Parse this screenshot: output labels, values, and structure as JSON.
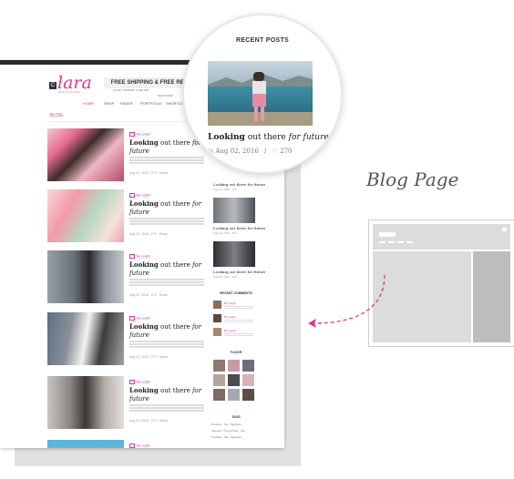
{
  "logo": {
    "box": "C",
    "name": "lara",
    "tagline": "SEW FASHION"
  },
  "promo": {
    "title": "FREE SHIPPING & FREE RETURNS",
    "subtitle": "ON ALL ORDERS OVER $99",
    "link": "SHOP NOW"
  },
  "nav": {
    "items": [
      "HOME",
      "SHOP",
      "PAGES",
      "PORTFOLIO",
      "SHORTCODES"
    ]
  },
  "breadcrumb": "BLOG",
  "posts": [
    {
      "category": "By Leight",
      "title_bold": "Looking",
      "title_plain": "out there",
      "title_italic": "for",
      "title_line2": "future",
      "meta": "Aug 02, 2016 · 270 · Share"
    },
    {
      "category": "By Leight",
      "title_bold": "Looking",
      "title_plain": "out there",
      "title_italic": "for",
      "title_line2": "future",
      "meta": "Aug 02, 2016 · 270 · Share"
    },
    {
      "category": "By Leight",
      "title_bold": "Looking",
      "title_plain": "out there",
      "title_italic": "for",
      "title_line2": "future",
      "meta": "Aug 02, 2016 · 270 · Share"
    },
    {
      "category": "By Leight",
      "title_bold": "Looking",
      "title_plain": "out there",
      "title_italic": "for",
      "title_line2": "future",
      "meta": "Aug 02, 2016 · 270 · Share"
    },
    {
      "category": "By Leight",
      "title_bold": "Looking",
      "title_plain": "out there",
      "title_italic": "for",
      "title_line2": "future",
      "meta": "Aug 02, 2016 · 270 · Share"
    },
    {
      "category": "By Leight",
      "title_bold": "",
      "title_plain": "",
      "title_italic": "",
      "title_line2": "",
      "meta": ""
    }
  ],
  "sidebar": {
    "recent_posts": [
      {
        "title": "Looking out there for future",
        "meta": "Aug 02, 2016 · 270"
      },
      {
        "title": "Looking out there for future",
        "meta": "Aug 02, 2016 · 270"
      },
      {
        "title": "Looking out there for future",
        "meta": "Aug 02, 2016 · 270"
      }
    ],
    "comments_heading": "RECENT COMMENTS",
    "comments": [
      {
        "name": "By Leight"
      },
      {
        "name": "By Leight"
      },
      {
        "name": "By Leight"
      }
    ],
    "flickr_heading": "FLICKR",
    "tags_heading": "TAGS",
    "tags": [
      "Prodotto",
      "Pai",
      "Sigaretto",
      "Sitecore",
      "Proporzione",
      "Ate",
      "Prodotto",
      "Pai",
      "Sigaretto"
    ]
  },
  "magnifier": {
    "heading": "RECENT POSTS",
    "title_bold": "Looking",
    "title_plain": "out there",
    "title_italic": "for future",
    "date": "Aug 02, 2016",
    "likes": "270"
  },
  "label": "Blog Page",
  "colors": {
    "accent": "#e0348f",
    "dark": "#2b2b2b",
    "wire_light": "#dcdcdc",
    "wire_dark": "#bdbdbd"
  }
}
